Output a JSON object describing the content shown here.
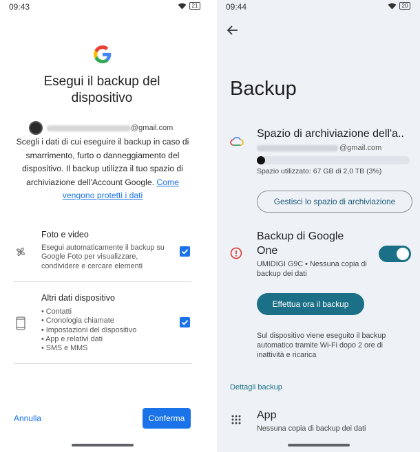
{
  "left": {
    "status": {
      "time": "09:43",
      "battery": "21"
    },
    "title": "Esegui il backup del dispositivo",
    "account_suffix": "@gmail.com",
    "description": "Scegli i dati di cui eseguire il backup in caso di smarrimento, furto o danneggiamento del dispositivo. Il backup utilizza il tuo spazio di archiviazione dell'Account Google.",
    "link_text": "Come vengono protetti i dati",
    "options": [
      {
        "title": "Foto e video",
        "description": "Esegui automaticamente il backup su Google Foto per visualizzare, condividere e cercare elementi",
        "checked": true,
        "icon": "pinwheel-icon"
      },
      {
        "title": "Altri dati dispositivo",
        "items": [
          "• Contatti",
          "• Cronologia chiamate",
          "• Impostazioni del dispositivo",
          "• App e relativi dati",
          "• SMS e MMS"
        ],
        "checked": true,
        "icon": "phone-icon"
      }
    ],
    "cancel_label": "Annulla",
    "confirm_label": "Conferma"
  },
  "right": {
    "status": {
      "time": "09:44",
      "battery": "20"
    },
    "title": "Backup",
    "storage": {
      "title": "Spazio di archiviazione dell'a..",
      "account_suffix": "@gmail.com",
      "usage": "Spazio utilizzato: 67 GB di 2,0 TB (3%)",
      "usage_fraction": 0.03,
      "manage_label": "Gestisci lo spazio di archiviazione"
    },
    "google_one": {
      "title": "Backup di Google One",
      "subtitle": "UMIDIGI G9C • Nessuna copia di backup dei dati",
      "enabled": true,
      "backup_now_label": "Effettua ora il backup",
      "note": "Sul dispositivo viene eseguito il backup automatico tramite Wi-Fi dopo 2 ore di inattività e ricarica"
    },
    "details_header": "Dettagli backup",
    "app": {
      "title": "App",
      "subtitle": "Nessuna copia di backup dei dati"
    }
  },
  "colors": {
    "accent_blue": "#1a73e8",
    "teal": "#1b6f86",
    "warning_red": "#d93025"
  }
}
